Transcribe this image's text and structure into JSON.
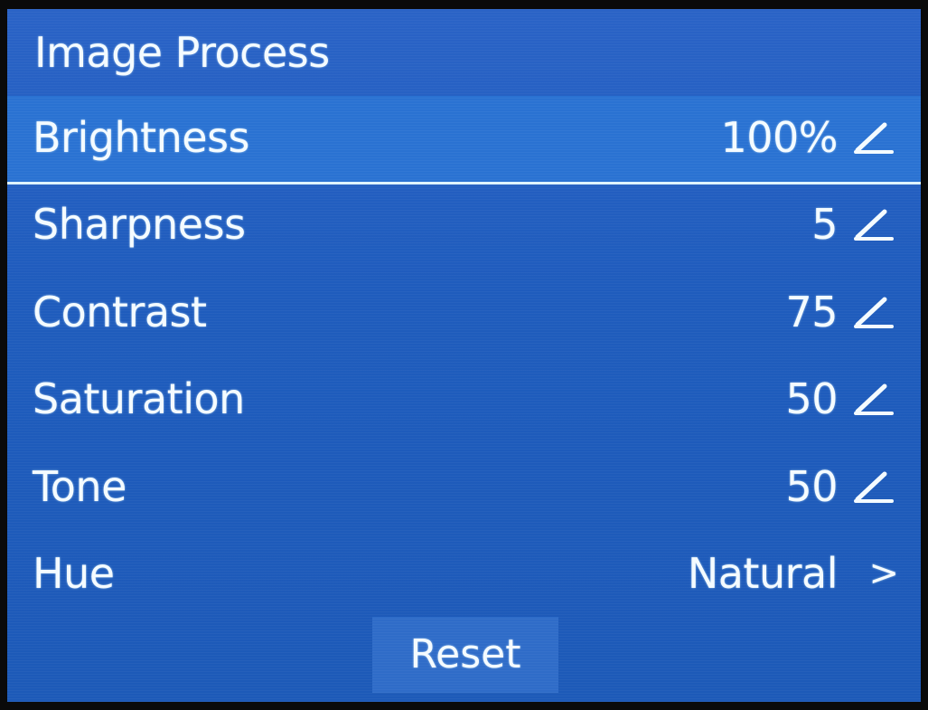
{
  "menu": {
    "title": "Image Process",
    "items": [
      {
        "label": "Brightness",
        "value": "100%",
        "icon": "pencil-icon",
        "selected": true
      },
      {
        "label": "Sharpness",
        "value": "5",
        "icon": "pencil-icon"
      },
      {
        "label": "Contrast",
        "value": "75",
        "icon": "pencil-icon"
      },
      {
        "label": "Saturation",
        "value": "50",
        "icon": "pencil-icon"
      },
      {
        "label": "Tone",
        "value": "50",
        "icon": "pencil-icon"
      },
      {
        "label": "Hue",
        "value": "Natural",
        "icon": "chevron-right-icon",
        "chevron": ">"
      }
    ],
    "reset_label": "Reset"
  },
  "colors": {
    "background": "#1f5fbf",
    "selected_row": "#2a72d2",
    "text": "#f4fbff"
  }
}
